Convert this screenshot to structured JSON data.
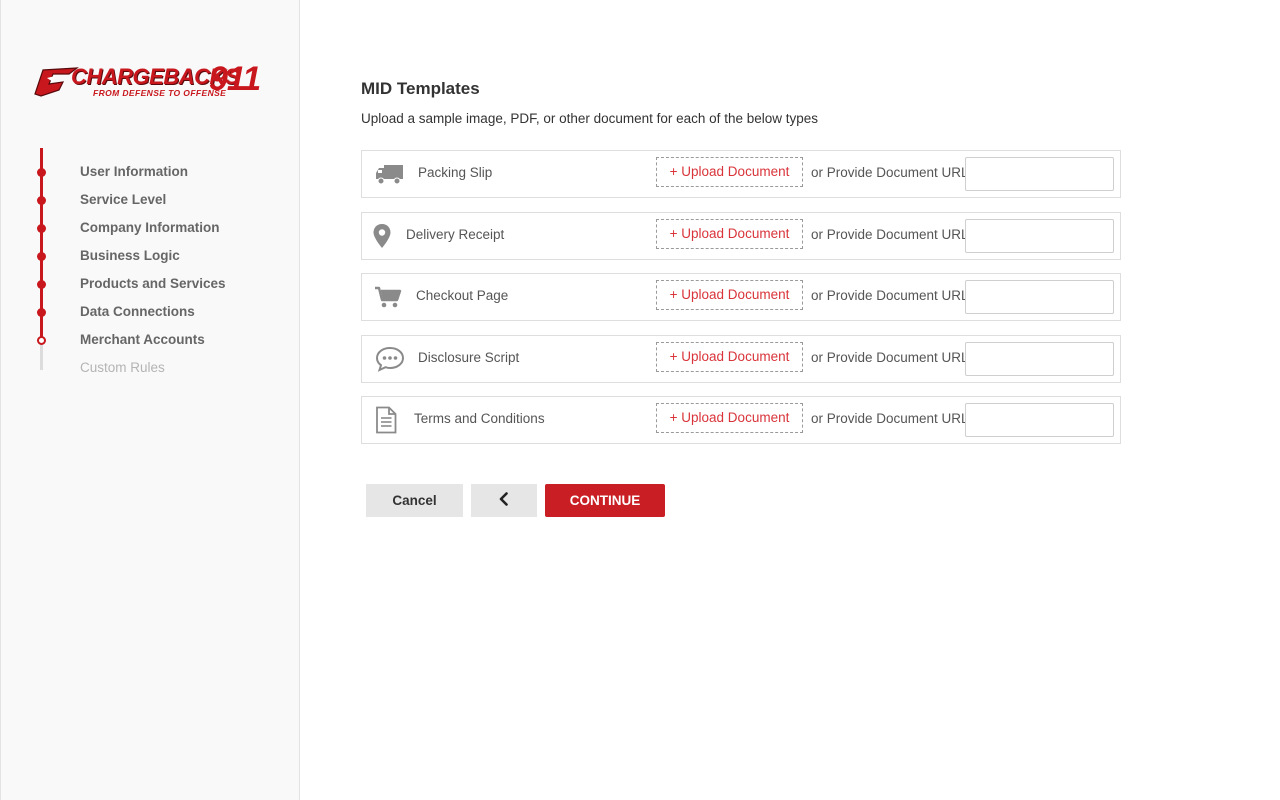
{
  "brand": {
    "name": "CHARGEBACKS",
    "number": "911",
    "tagline": "FROM DEFENSE TO OFFENSE",
    "color": "#c8181e"
  },
  "sidebar": {
    "steps": [
      {
        "label": "User Information",
        "state": "done"
      },
      {
        "label": "Service Level",
        "state": "done"
      },
      {
        "label": "Company Information",
        "state": "done"
      },
      {
        "label": "Business Logic",
        "state": "done"
      },
      {
        "label": "Products and Services",
        "state": "done"
      },
      {
        "label": "Data Connections",
        "state": "done"
      },
      {
        "label": "Merchant Accounts",
        "state": "current"
      },
      {
        "label": "Custom Rules",
        "state": "pending"
      }
    ]
  },
  "main": {
    "title": "MID Templates",
    "subtitle": "Upload a sample image, PDF, or other document for each of the below types",
    "rows": [
      {
        "label": "Packing Slip",
        "icon": "truck-icon",
        "upload_label": "+ Upload Document",
        "or_label": "or Provide Document URL",
        "url_value": ""
      },
      {
        "label": "Delivery Receipt",
        "icon": "map-pin-icon",
        "upload_label": "+ Upload Document",
        "or_label": "or Provide Document URL",
        "url_value": ""
      },
      {
        "label": "Checkout Page",
        "icon": "shopping-cart-icon",
        "upload_label": "+ Upload Document",
        "or_label": "or Provide Document URL",
        "url_value": ""
      },
      {
        "label": "Disclosure Script",
        "icon": "speech-bubble-icon",
        "upload_label": "+ Upload Document",
        "or_label": "or Provide Document URL",
        "url_value": ""
      },
      {
        "label": "Terms and Conditions",
        "icon": "document-icon",
        "upload_label": "+ Upload Document",
        "or_label": "or Provide Document URL",
        "url_value": ""
      }
    ]
  },
  "actions": {
    "cancel_label": "Cancel",
    "back_icon": "chevron-left-icon",
    "continue_label": "CONTINUE"
  }
}
